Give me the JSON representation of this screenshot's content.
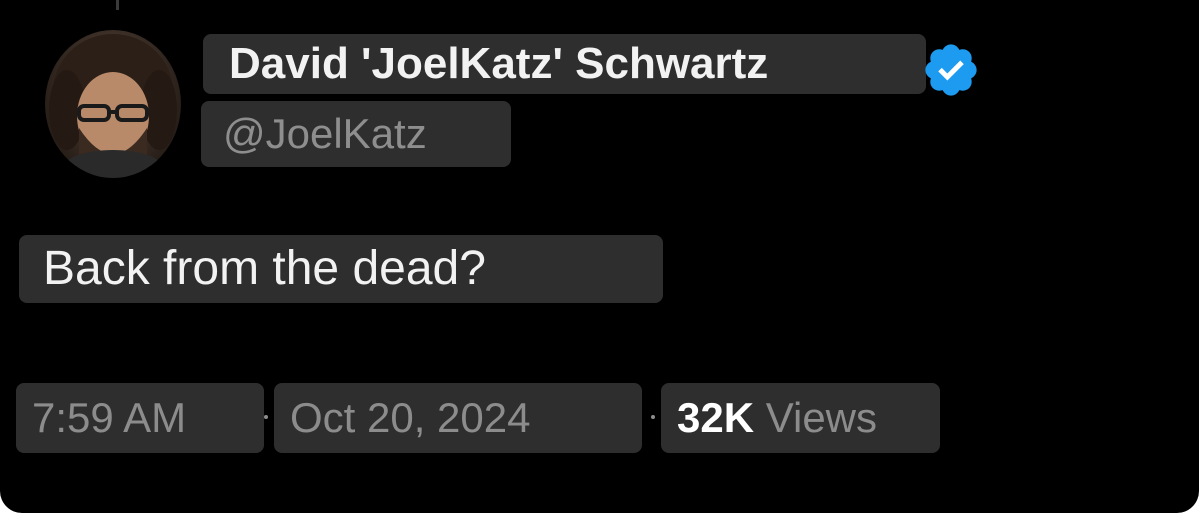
{
  "post": {
    "author": {
      "display_name": "David 'JoelKatz' Schwartz",
      "handle": "@JoelKatz",
      "verified": true,
      "verified_icon": "verified-badge-icon",
      "verified_color": "#1d9bf0"
    },
    "text": "Back from the dead?",
    "meta": {
      "time": "7:59 AM",
      "date": "Oct 20, 2024",
      "views_count": "32K",
      "views_label": "Views"
    }
  },
  "theme": {
    "background": "#000000",
    "primary_text": "#f2f2f2",
    "secondary_text": "#8e8e8e"
  }
}
